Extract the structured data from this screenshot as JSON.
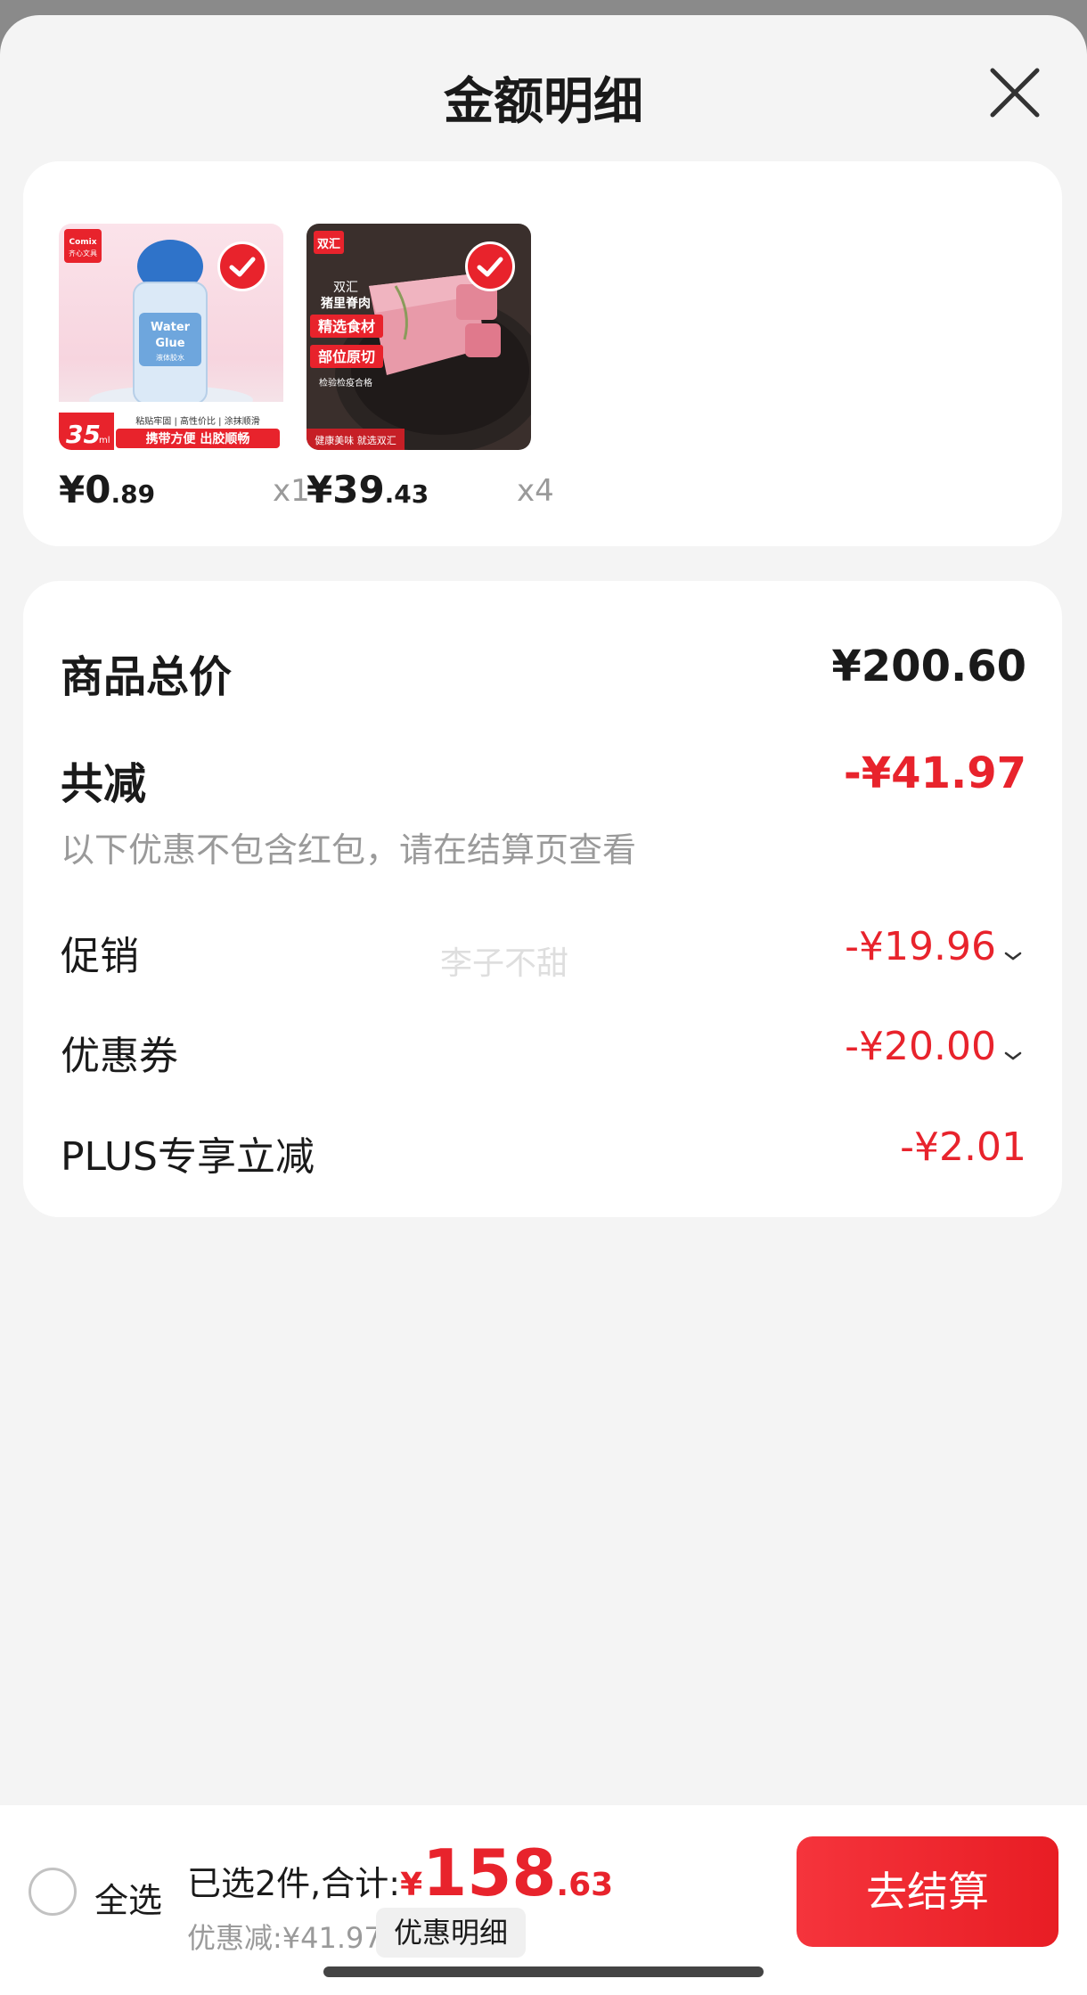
{
  "header": {
    "title": "金额明细"
  },
  "products": [
    {
      "brand": "Comix 齐心文具",
      "price_int": "¥0",
      "price_dec": ".89",
      "qty": "x1",
      "image_text": [
        "Water Glue",
        "35ml",
        "粘贴牢固",
        "高性价比",
        "涂抹顺滑",
        "携带方便 出胶顺畅"
      ]
    },
    {
      "brand": "双汇",
      "price_int": "¥39",
      "price_dec": ".43",
      "qty": "x4",
      "image_text": [
        "双汇",
        "猪里脊肉",
        "精选食材",
        "部位原切",
        "检验检疫合格",
        "健康美味 就选双汇"
      ]
    }
  ],
  "summary": {
    "total_label": "商品总价",
    "total_value": "¥200.60",
    "reduce_label": "共减",
    "reduce_value": "-¥41.97",
    "note": "以下优惠不包含红包，请在结算页查看",
    "promo_label": "促销",
    "promo_value": "-¥19.96",
    "coupon_label": "优惠券",
    "coupon_value": "-¥20.00",
    "plus_label": "PLUS专享立减",
    "plus_value": "-¥2.01",
    "watermark": "李子不甜"
  },
  "footer": {
    "select_all": "全选",
    "selected_label": "已选2件,合计:",
    "currency": "¥",
    "total_int": "158",
    "total_dec": ".63",
    "discount_text": "优惠减:¥41.97",
    "detail_button": "优惠明细",
    "checkout_button": "去结算"
  },
  "colors": {
    "accent": "#e8232c",
    "background": "#f4f4f4",
    "card": "#ffffff",
    "muted": "#9a9a9a"
  }
}
